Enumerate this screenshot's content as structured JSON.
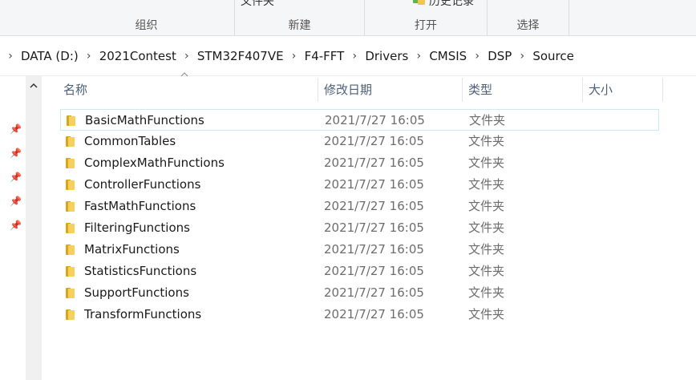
{
  "ribbon": {
    "groups": [
      {
        "label": "组织",
        "cut_text": ""
      },
      {
        "label": "新建",
        "cut_text": "文件夹"
      },
      {
        "label": "打开",
        "cut_text": "历史记录"
      },
      {
        "label": "选择",
        "cut_text": ""
      }
    ]
  },
  "address_bar": {
    "crumbs": [
      "DATA (D:)",
      "2021Contest",
      "STM32F407VE",
      "F4-FFT",
      "Drivers",
      "CMSIS",
      "DSP",
      "Source"
    ]
  },
  "nav_pane": {
    "scroll_up_icon": "chevron-up-icon",
    "pin_icon": "pin-icon",
    "pin_count": 5
  },
  "columns": {
    "name": "名称",
    "date": "修改日期",
    "type": "类型",
    "size": "大小"
  },
  "files": [
    {
      "name": "BasicMathFunctions",
      "date": "2021/7/27 16:05",
      "type": "文件夹"
    },
    {
      "name": "CommonTables",
      "date": "2021/7/27 16:05",
      "type": "文件夹"
    },
    {
      "name": "ComplexMathFunctions",
      "date": "2021/7/27 16:05",
      "type": "文件夹"
    },
    {
      "name": "ControllerFunctions",
      "date": "2021/7/27 16:05",
      "type": "文件夹"
    },
    {
      "name": "FastMathFunctions",
      "date": "2021/7/27 16:05",
      "type": "文件夹"
    },
    {
      "name": "FilteringFunctions",
      "date": "2021/7/27 16:05",
      "type": "文件夹"
    },
    {
      "name": "MatrixFunctions",
      "date": "2021/7/27 16:05",
      "type": "文件夹"
    },
    {
      "name": "StatisticsFunctions",
      "date": "2021/7/27 16:05",
      "type": "文件夹"
    },
    {
      "name": "SupportFunctions",
      "date": "2021/7/27 16:05",
      "type": "文件夹"
    },
    {
      "name": "TransformFunctions",
      "date": "2021/7/27 16:05",
      "type": "文件夹"
    }
  ],
  "selected_index": 0,
  "colors": {
    "folder_front": "#f7d05b",
    "folder_back": "#d9a519",
    "header_text": "#4c607a",
    "selection_border": "#cde8f7"
  }
}
